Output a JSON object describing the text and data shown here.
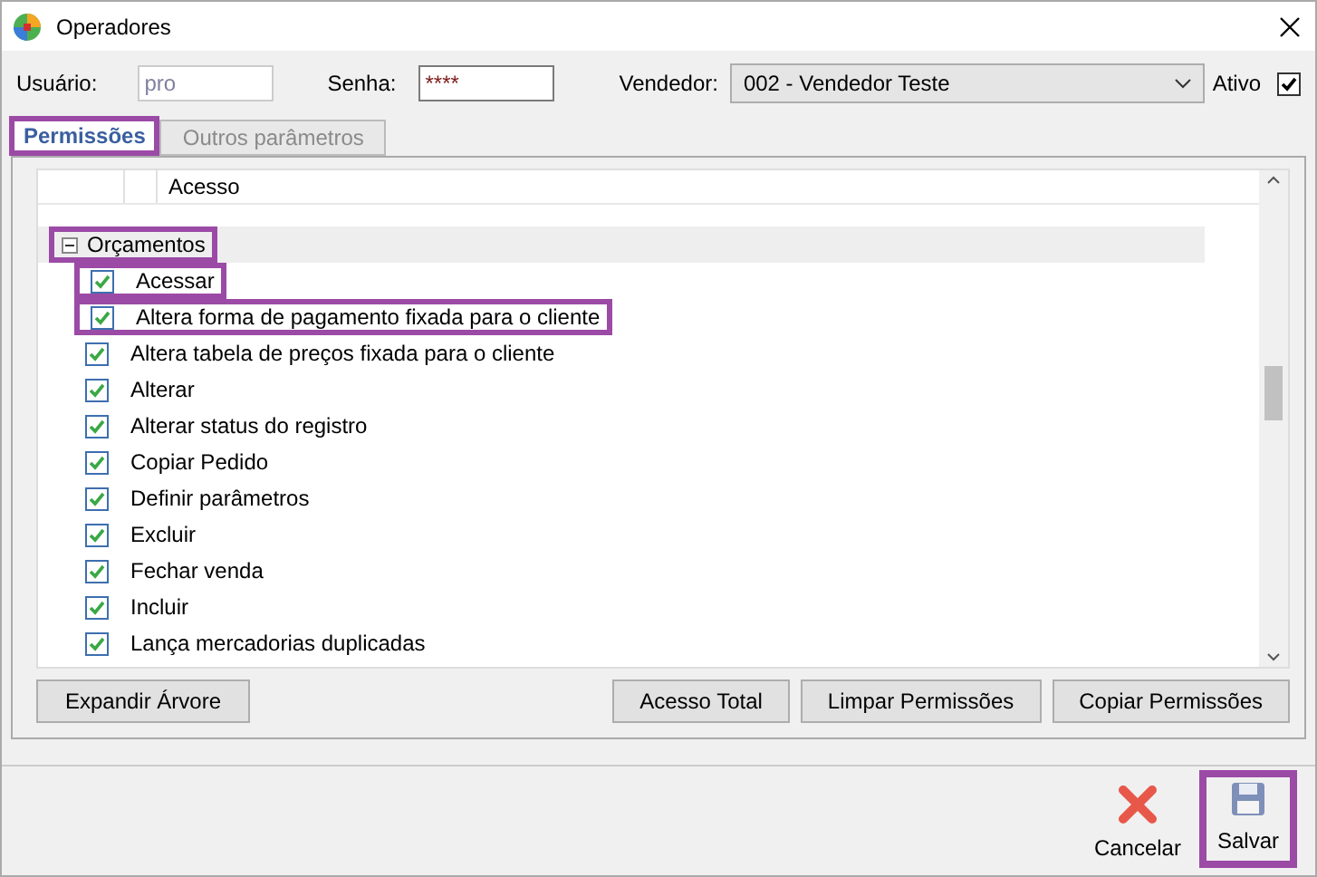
{
  "window": {
    "title": "Operadores"
  },
  "fields": {
    "usuario": {
      "label": "Usuário:",
      "value": "pro",
      "disabled": true
    },
    "senha": {
      "label": "Senha:",
      "value": "****"
    },
    "vendedor": {
      "label": "Vendedor:",
      "value": "002 - Vendedor Teste"
    },
    "ativo": {
      "label": "Ativo",
      "checked": true
    }
  },
  "tabs": [
    {
      "label": "Permissões",
      "selected": true,
      "highlighted": true
    },
    {
      "label": "Outros parâmetros",
      "selected": false,
      "highlighted": false
    }
  ],
  "tree": {
    "column": "Acesso",
    "groups": [
      {
        "label": "Orçamentos",
        "expanded": true,
        "highlighted": true,
        "children": [
          {
            "label": "Acessar",
            "checked": true,
            "highlighted": true
          },
          {
            "label": "Altera forma de pagamento fixada para o cliente",
            "checked": true,
            "highlighted": true
          },
          {
            "label": "Altera tabela de preços fixada para o cliente",
            "checked": true,
            "highlighted": false
          },
          {
            "label": "Alterar",
            "checked": true,
            "highlighted": false
          },
          {
            "label": "Alterar status do registro",
            "checked": true,
            "highlighted": false
          },
          {
            "label": "Copiar Pedido",
            "checked": true,
            "highlighted": false
          },
          {
            "label": "Definir parâmetros",
            "checked": true,
            "highlighted": false
          },
          {
            "label": "Excluir",
            "checked": true,
            "highlighted": false
          },
          {
            "label": "Fechar venda",
            "checked": true,
            "highlighted": false
          },
          {
            "label": "Incluir",
            "checked": true,
            "highlighted": false
          },
          {
            "label": "Lança mercadorias duplicadas",
            "checked": true,
            "highlighted": false
          }
        ]
      }
    ]
  },
  "panel_buttons": [
    {
      "label": "Expandir Árvore",
      "kind": "left"
    },
    {
      "label": "Acesso Total",
      "kind": "right"
    },
    {
      "label": "Limpar Permissões",
      "kind": "right"
    },
    {
      "label": "Copiar Permissões",
      "kind": "right"
    }
  ],
  "actions": [
    {
      "label": "Cancelar",
      "kind": "cancel",
      "highlighted": false
    },
    {
      "label": "Salvar",
      "kind": "save",
      "highlighted": true
    }
  ]
}
